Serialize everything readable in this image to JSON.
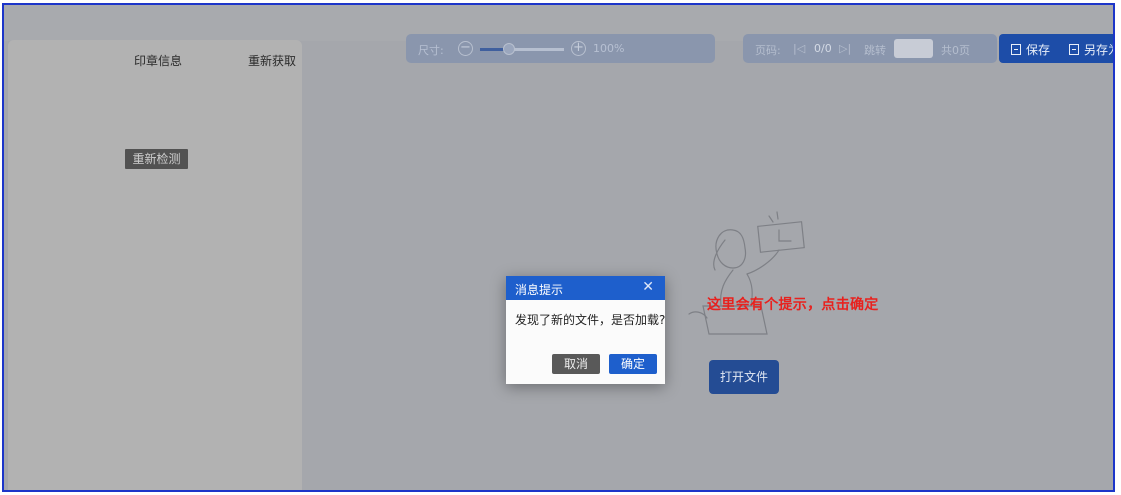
{
  "left_panel": {
    "tabs": [
      "印章信息",
      "重新获取"
    ],
    "recheck_label": "重新检测"
  },
  "zoom": {
    "label": "尺寸:",
    "minus_glyph": "−",
    "plus_glyph": "+",
    "value_text": "100%",
    "slider_level_percent": 35
  },
  "pager": {
    "label": "页码:",
    "first_glyph": "|◁",
    "current_text": "0/0",
    "next_glyph": "▷|",
    "jump_label": "跳转",
    "total_text": "共0页"
  },
  "toolbar": {
    "save_label": "保存",
    "save_as_label": "另存为"
  },
  "main": {
    "open_file_label": "打开文件"
  },
  "annotation": {
    "text": "这里会有个提示，点击确定"
  },
  "dialog": {
    "title": "消息提示",
    "close_glyph": "✕",
    "message": "发现了新的文件，是否加载?",
    "cancel_label": "取消",
    "ok_label": "确定"
  },
  "colors": {
    "dialog_header": "#1e5fcc",
    "annotation": "#e8211e",
    "frame_border": "#1c35c9",
    "overlay": "#a5a7ac"
  }
}
